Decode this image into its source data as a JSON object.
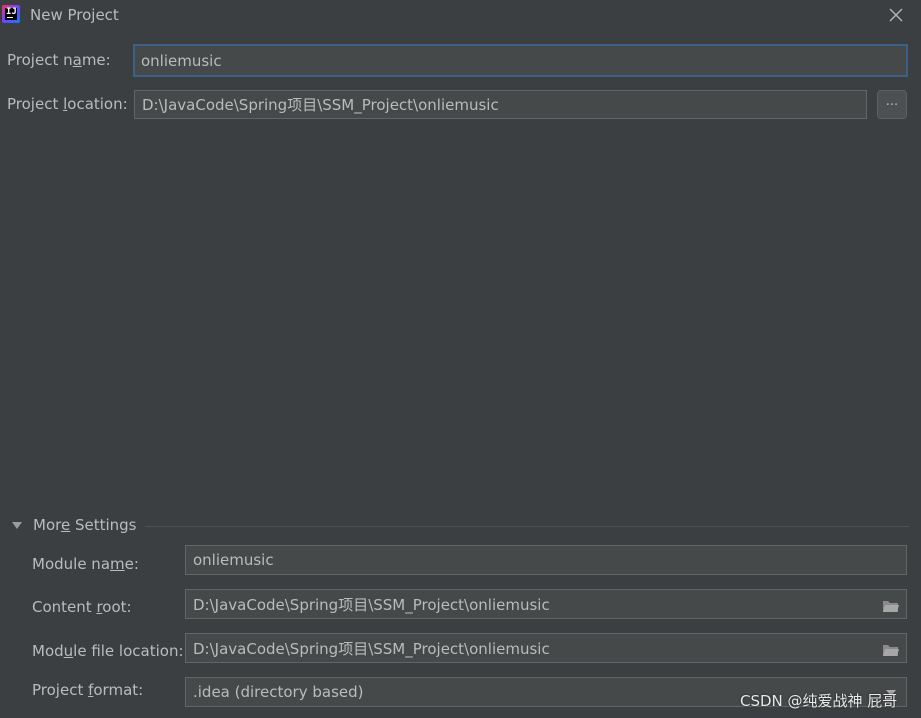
{
  "window": {
    "title": "New Project",
    "close_icon": "close-icon",
    "app_icon": "intellij-idea-icon"
  },
  "project": {
    "name_label_pre": "Project n",
    "name_label_mnemonic": "a",
    "name_label_post": "me:",
    "name_value": "onliemusic",
    "location_label_pre": "Project ",
    "location_label_mnemonic": "l",
    "location_label_post": "ocation:",
    "location_value": "D:\\JavaCode\\Spring项目\\SSM_Project\\onliemusic",
    "browse_button_label": "..."
  },
  "more_settings": {
    "label_pre": "Mor",
    "label_mnemonic": "e",
    "label_post": " Settings",
    "expanded": true,
    "module_name_label_pre": "Module na",
    "module_name_label_mnemonic": "m",
    "module_name_label_post": "e:",
    "module_name_value": "onliemusic",
    "content_root_label_pre": "Content ",
    "content_root_label_mnemonic": "r",
    "content_root_label_post": "oot:",
    "content_root_value": "D:\\JavaCode\\Spring项目\\SSM_Project\\onliemusic",
    "module_file_label_pre": "Mod",
    "module_file_label_mnemonic": "u",
    "module_file_label_post": "le file location:",
    "module_file_value": "D:\\JavaCode\\Spring项目\\SSM_Project\\onliemusic",
    "format_label_pre": "Project ",
    "format_label_mnemonic": "f",
    "format_label_post": "ormat:",
    "format_value": ".idea (directory based)"
  },
  "watermark": "CSDN @纯爱战神 屁哥",
  "colors": {
    "background": "#3c3f41",
    "field_background": "#45494a",
    "focus_border": "#3d6185",
    "text": "#bbbbbb"
  }
}
